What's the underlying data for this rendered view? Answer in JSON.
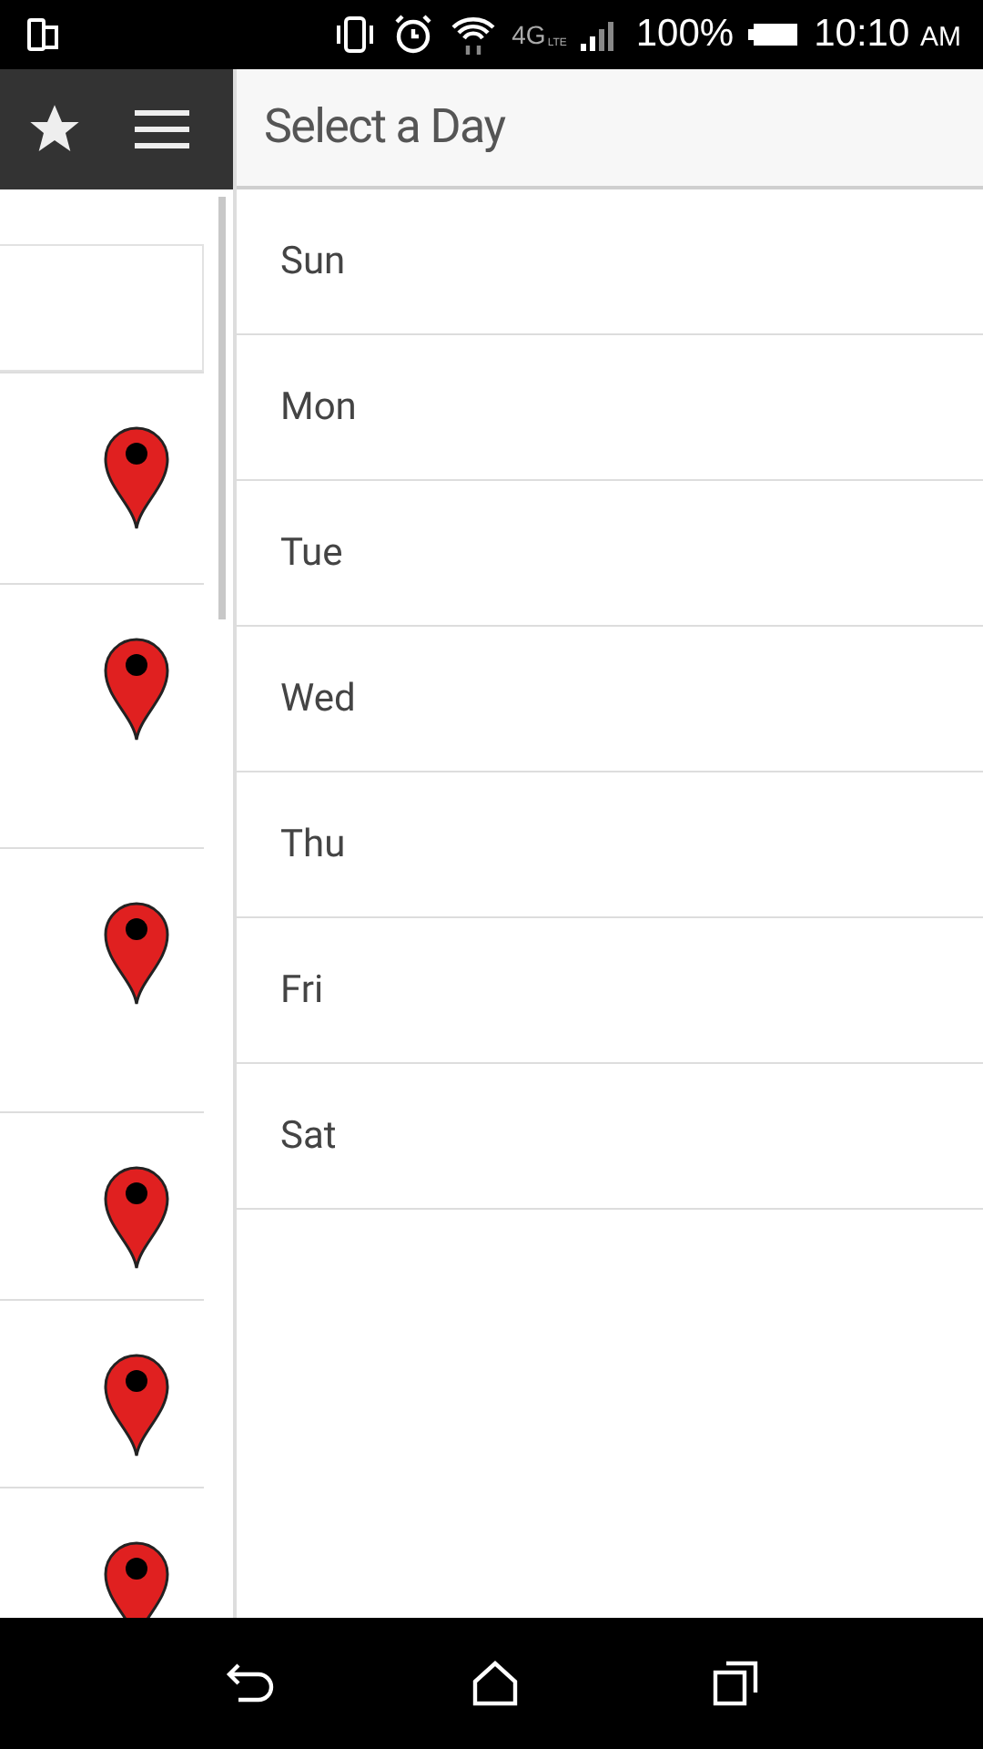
{
  "status_bar": {
    "network": "4G",
    "network_sub": "LTE",
    "battery": "100%",
    "time": "10:10",
    "meridiem": "AM"
  },
  "side_panel": {
    "rows": [
      {
        "kind": "field"
      },
      {
        "kind": "place"
      },
      {
        "kind": "place"
      },
      {
        "kind": "place"
      },
      {
        "kind": "place"
      },
      {
        "kind": "place"
      },
      {
        "kind": "place"
      }
    ]
  },
  "dialog": {
    "title": "Select a Day",
    "days": [
      {
        "label": "Sun"
      },
      {
        "label": "Mon"
      },
      {
        "label": "Tue"
      },
      {
        "label": "Wed"
      },
      {
        "label": "Thu"
      },
      {
        "label": "Fri"
      },
      {
        "label": "Sat"
      }
    ]
  }
}
